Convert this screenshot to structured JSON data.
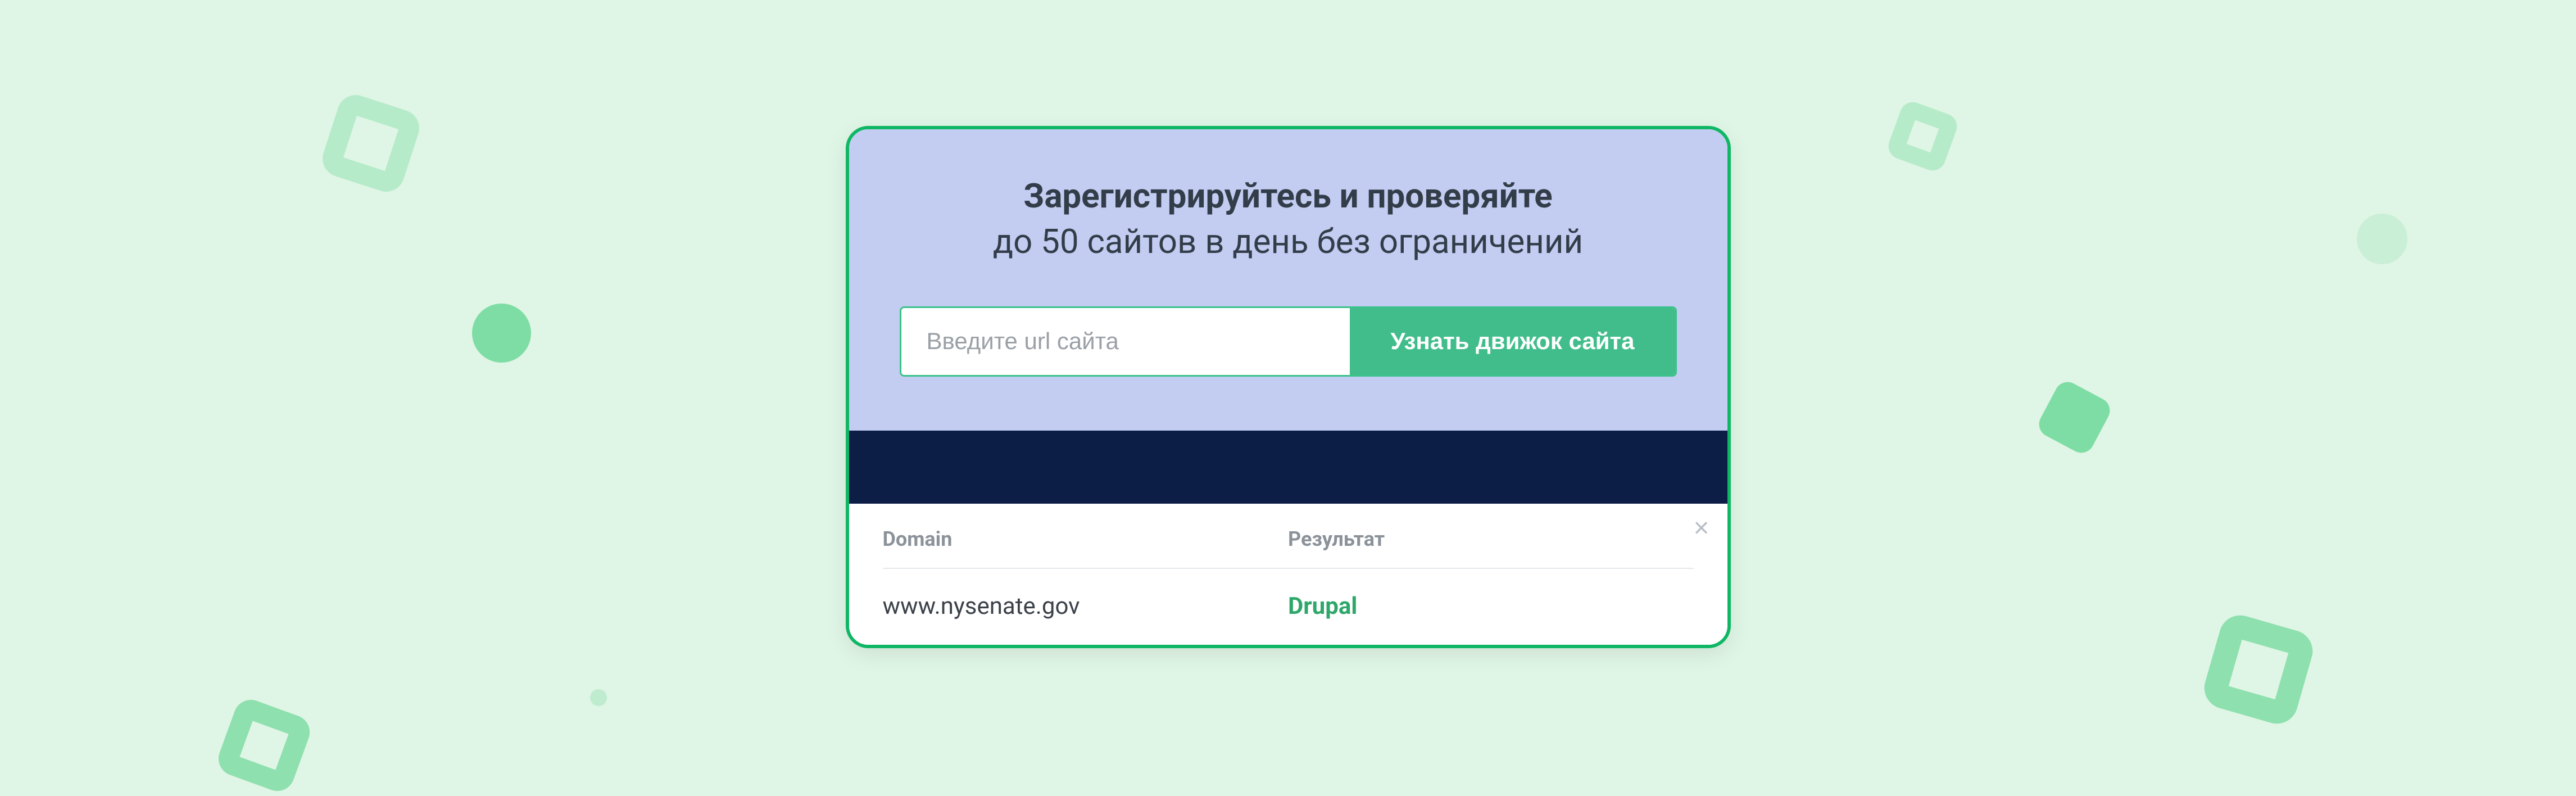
{
  "heading": {
    "line1": "Зарегистрируйтесь и проверяйте",
    "line2": "до 50 сайтов в день без ограничений"
  },
  "form": {
    "placeholder": "Введите url сайта",
    "button_label": "Узнать движок сайта"
  },
  "results": {
    "close_glyph": "×",
    "header_domain": "Domain",
    "header_result": "Результат",
    "rows": [
      {
        "domain": "www.nysenate.gov",
        "result": "Drupal"
      }
    ]
  }
}
